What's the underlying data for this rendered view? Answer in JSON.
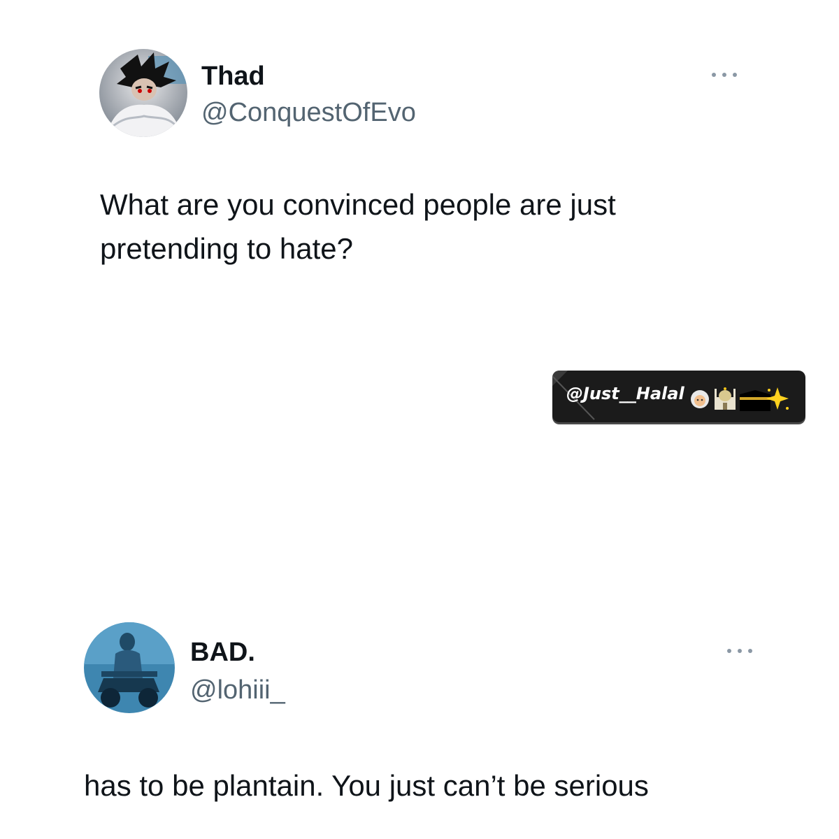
{
  "tweet": {
    "author_name": "Thad",
    "author_handle": "@ConquestOfEvo",
    "text_line1": "What are you convinced people are just",
    "text_line2": "pretending to hate?"
  },
  "watermark": {
    "text": "@Just__Halal"
  },
  "reply": {
    "author_name": "BAD.",
    "author_handle": "@lohiii_",
    "text": "has to be plantain. You just can’t be serious"
  },
  "icons": {
    "more": "more-horizontal-icon",
    "watermark_emojis": [
      "woman-with-headscarf-icon",
      "mosque-icon",
      "kaaba-icon",
      "sparkle-icon"
    ]
  },
  "colors": {
    "text_primary": "#0f1419",
    "text_secondary": "#536471",
    "more_icon": "#8b98a5",
    "watermark_bg": "#1b1b1b"
  }
}
